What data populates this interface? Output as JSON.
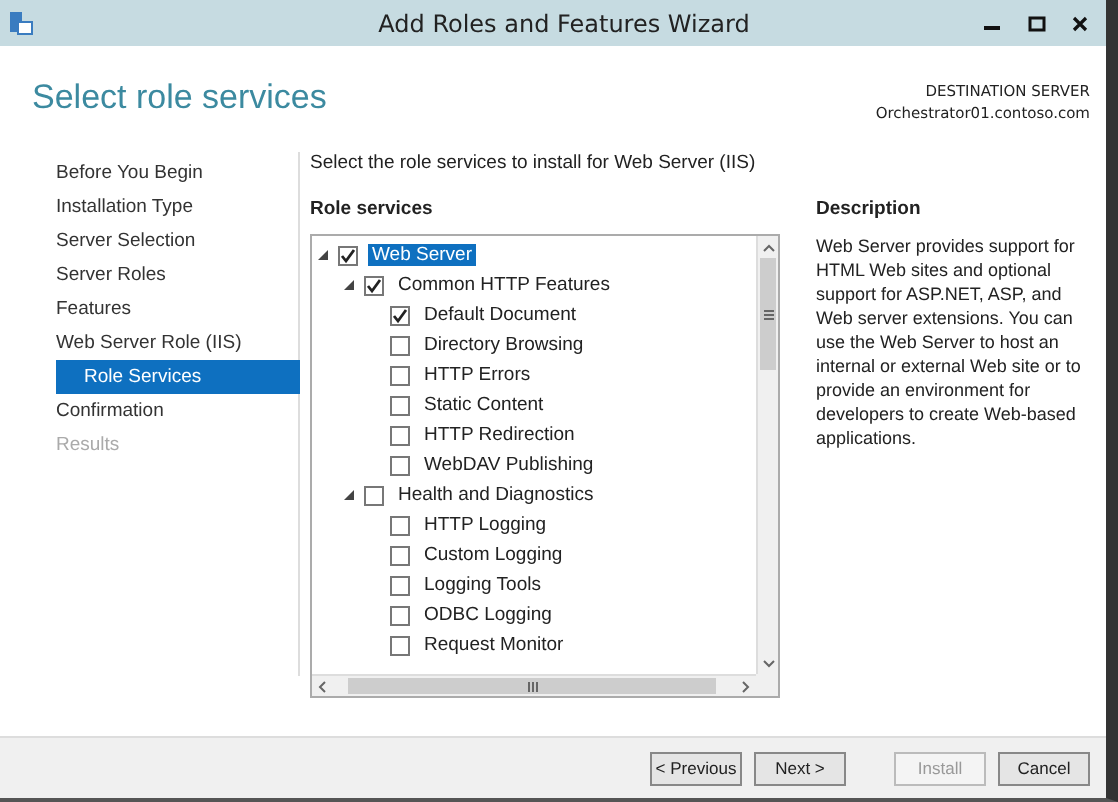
{
  "window": {
    "title": "Add Roles and Features Wizard"
  },
  "page_title": "Select role services",
  "destination": {
    "label": "DESTINATION SERVER",
    "server": "Orchestrator01.contoso.com"
  },
  "nav": [
    {
      "label": "Before You Begin",
      "selected": false,
      "disabled": false,
      "sub": false
    },
    {
      "label": "Installation Type",
      "selected": false,
      "disabled": false,
      "sub": false
    },
    {
      "label": "Server Selection",
      "selected": false,
      "disabled": false,
      "sub": false
    },
    {
      "label": "Server Roles",
      "selected": false,
      "disabled": false,
      "sub": false
    },
    {
      "label": "Features",
      "selected": false,
      "disabled": false,
      "sub": false
    },
    {
      "label": "Web Server Role (IIS)",
      "selected": false,
      "disabled": false,
      "sub": false
    },
    {
      "label": "Role Services",
      "selected": true,
      "disabled": false,
      "sub": true
    },
    {
      "label": "Confirmation",
      "selected": false,
      "disabled": false,
      "sub": false
    },
    {
      "label": "Results",
      "selected": false,
      "disabled": true,
      "sub": false
    }
  ],
  "instruction": "Select the role services to install for Web Server (IIS)",
  "tree": {
    "heading": "Role services",
    "items": [
      {
        "label": "Web Server",
        "checked": true,
        "selected": true,
        "expanded": true,
        "children": [
          {
            "label": "Common HTTP Features",
            "checked": true,
            "selected": false,
            "expanded": true,
            "children": [
              {
                "label": "Default Document",
                "checked": true,
                "selected": false
              },
              {
                "label": "Directory Browsing",
                "checked": false,
                "selected": false
              },
              {
                "label": "HTTP Errors",
                "checked": false,
                "selected": false
              },
              {
                "label": "Static Content",
                "checked": false,
                "selected": false
              },
              {
                "label": "HTTP Redirection",
                "checked": false,
                "selected": false
              },
              {
                "label": "WebDAV Publishing",
                "checked": false,
                "selected": false
              }
            ]
          },
          {
            "label": "Health and Diagnostics",
            "checked": false,
            "selected": false,
            "expanded": true,
            "children": [
              {
                "label": "HTTP Logging",
                "checked": false,
                "selected": false
              },
              {
                "label": "Custom Logging",
                "checked": false,
                "selected": false
              },
              {
                "label": "Logging Tools",
                "checked": false,
                "selected": false
              },
              {
                "label": "ODBC Logging",
                "checked": false,
                "selected": false
              },
              {
                "label": "Request Monitor",
                "checked": false,
                "selected": false
              }
            ]
          }
        ]
      }
    ]
  },
  "description": {
    "heading": "Description",
    "text": "Web Server provides support for HTML Web sites and optional support for ASP.NET, ASP, and Web server extensions. You can use the Web Server to host an internal or external Web site or to provide an environment for developers to create Web-based applications."
  },
  "buttons": [
    {
      "label": "< Previous",
      "disabled": false
    },
    {
      "label": "Next >",
      "disabled": false
    },
    {
      "label": "Install",
      "disabled": true
    },
    {
      "label": "Cancel",
      "disabled": false
    }
  ]
}
